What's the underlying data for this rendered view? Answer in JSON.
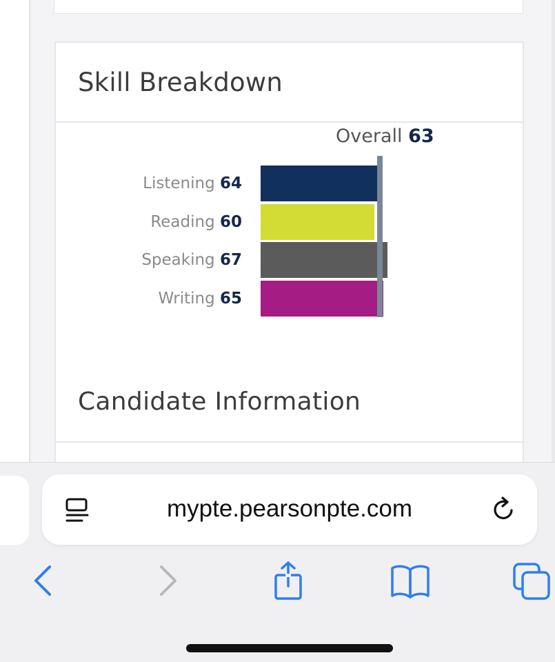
{
  "card": {
    "title": "Skill Breakdown",
    "overall_label": "Overall",
    "overall_value": "63",
    "next_section_title": "Candidate Information"
  },
  "chart_data": {
    "type": "bar",
    "orientation": "horizontal",
    "categories": [
      "Listening",
      "Reading",
      "Speaking",
      "Writing"
    ],
    "values": [
      64,
      60,
      67,
      65
    ],
    "colors": [
      "#12305e",
      "#d3dc35",
      "#5b5b5b",
      "#a51c84"
    ],
    "reference_line": {
      "label": "Overall",
      "value": 63
    }
  },
  "skills": [
    {
      "label": "Listening",
      "score": "64",
      "color": "#12305e"
    },
    {
      "label": "Reading",
      "score": "60",
      "color": "#d3dc35"
    },
    {
      "label": "Speaking",
      "score": "67",
      "color": "#5b5b5b"
    },
    {
      "label": "Writing",
      "score": "65",
      "color": "#a51c84"
    }
  ],
  "browser": {
    "url": "mypte.pearsonpte.com",
    "accent": "#2f7cf6"
  },
  "icons": {
    "reader": "reader-icon",
    "reload": "reload-icon",
    "back": "chevron-left-icon",
    "forward": "chevron-right-icon",
    "share": "share-icon",
    "bookmarks": "book-icon",
    "tabs": "tabs-icon"
  }
}
